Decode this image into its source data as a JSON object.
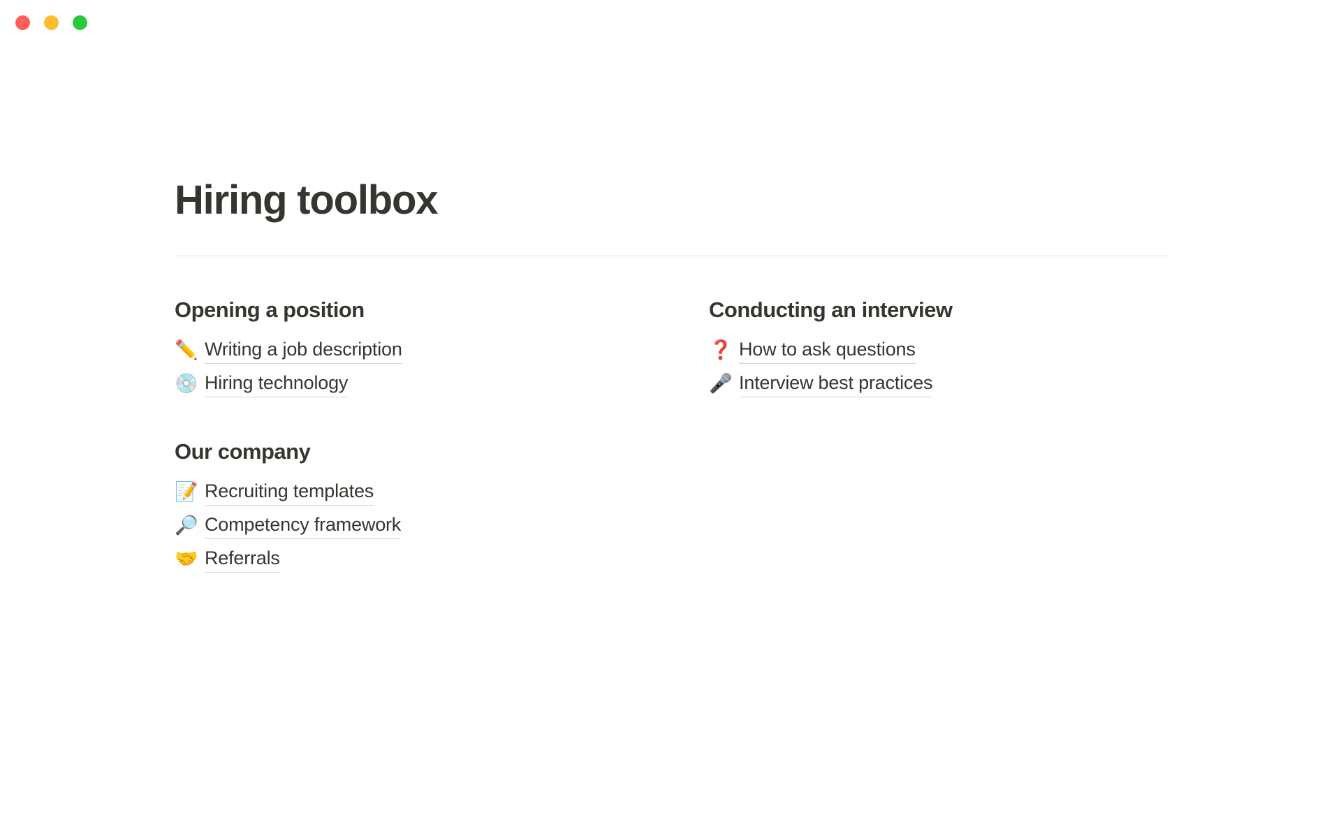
{
  "window": {
    "traffic_lights": [
      {
        "name": "close",
        "color": "#ff5f57"
      },
      {
        "name": "minimize",
        "color": "#febc2e"
      },
      {
        "name": "maximize",
        "color": "#28c840"
      }
    ]
  },
  "page": {
    "title": "Hiring toolbox",
    "columns": {
      "left": [
        {
          "heading": "Opening a position",
          "links": [
            {
              "emoji": "✏️",
              "icon_name": "pencil-icon",
              "label": "Writing a job description"
            },
            {
              "emoji": "💿",
              "icon_name": "optical-disk-icon",
              "label": "Hiring technology"
            }
          ]
        },
        {
          "heading": "Our company",
          "links": [
            {
              "emoji": "📝",
              "icon_name": "memo-icon",
              "label": "Recruiting templates"
            },
            {
              "emoji": "🔎",
              "icon_name": "magnifying-glass-icon",
              "label": "Competency framework"
            },
            {
              "emoji": "🤝",
              "icon_name": "handshake-icon",
              "label": "Referrals"
            }
          ]
        }
      ],
      "right": [
        {
          "heading": "Conducting an interview",
          "links": [
            {
              "emoji": "❓",
              "icon_name": "red-question-mark-icon",
              "label": "How to ask questions"
            },
            {
              "emoji": "🎤",
              "icon_name": "microphone-icon",
              "label": "Interview best practices"
            }
          ]
        }
      ]
    }
  },
  "colors": {
    "text": "#37352f",
    "divider": "#e4e4e2",
    "link_underline": "#d7d6d3",
    "background": "#ffffff"
  }
}
